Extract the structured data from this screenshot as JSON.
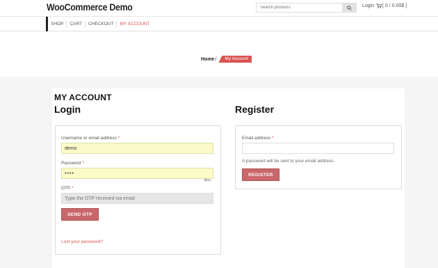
{
  "header": {
    "site_title": "WooCommerce Demo",
    "search_placeholder": "Search products",
    "login_label": "Login",
    "cart_label": "[ 0 / 0.00$ ]"
  },
  "nav": {
    "items": [
      {
        "label": "SHOP"
      },
      {
        "label": "CART"
      },
      {
        "label": "CHECKOUT"
      },
      {
        "label": "MY ACCOUNT"
      }
    ]
  },
  "breadcrumb": {
    "home": "Home",
    "separator": "/",
    "current": "My Account"
  },
  "page": {
    "title": "MY ACCOUNT"
  },
  "login": {
    "heading": "Login",
    "username_label": "Username or email address",
    "username_value": "demo",
    "password_label": "Password",
    "password_value": "••••",
    "otp_label": "OTP",
    "otp_placeholder": "Type the OTP received via email",
    "send_otp_button": "SEND OTP",
    "lost_password_link": "Lost your password?",
    "required_marker": "*"
  },
  "register": {
    "heading": "Register",
    "email_label": "Email address",
    "email_value": "",
    "help_text": "A password will be sent to your email address.",
    "register_button": "REGISTER",
    "required_marker": "*"
  },
  "icons": {
    "search": "search-icon",
    "cart": "cart-icon",
    "password_manager": "key-icon"
  },
  "colors": {
    "accent": "#d9534f",
    "button": "#c9676a",
    "autofill": "#fafbc8"
  }
}
